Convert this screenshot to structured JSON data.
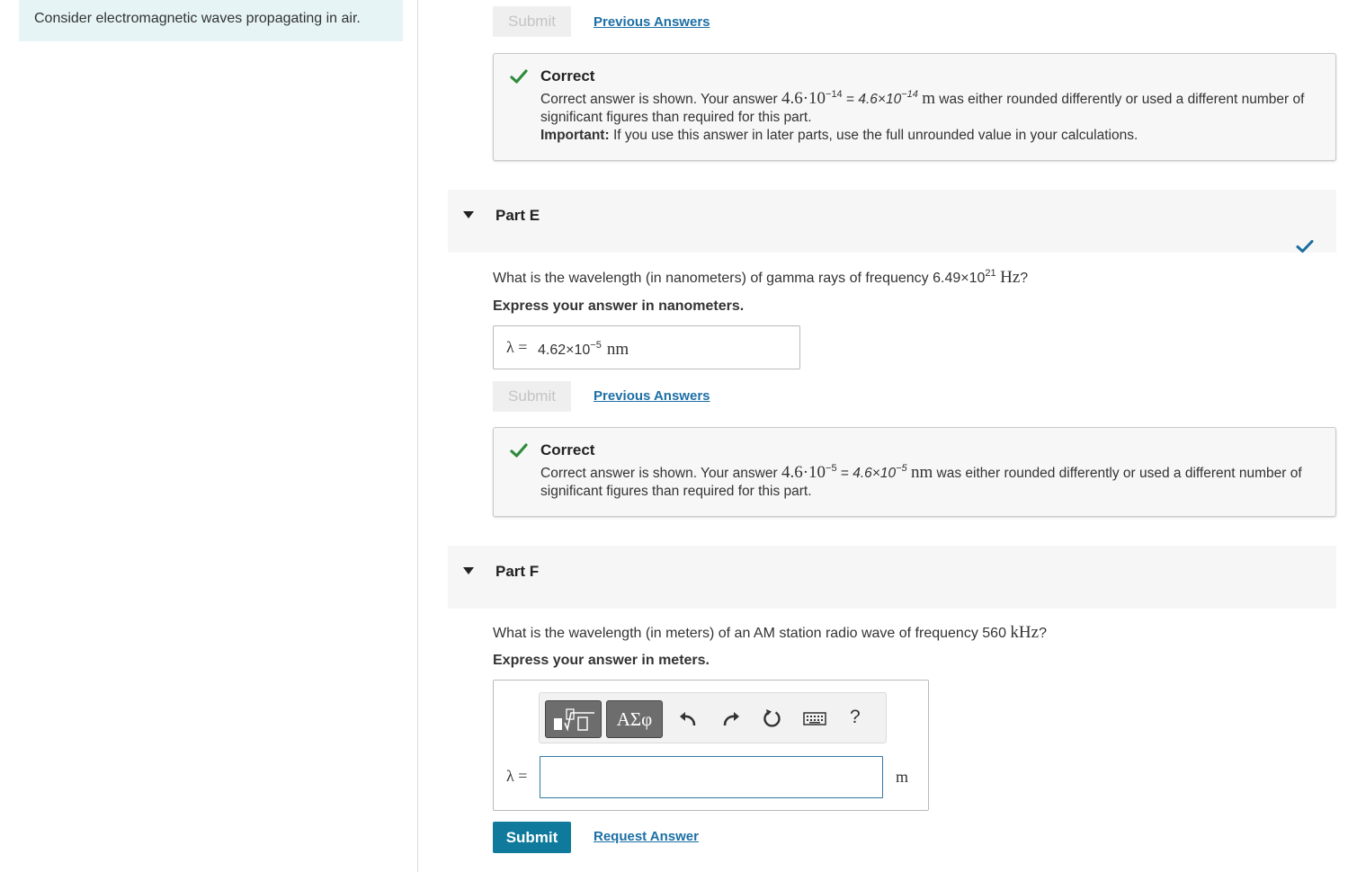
{
  "intro": {
    "text": "Consider electromagnetic waves propagating in air."
  },
  "part_d": {
    "submit_label": "Submit",
    "previous_answers": "Previous Answers",
    "feedback": {
      "title": "Correct",
      "line1_prefix": "Correct answer is shown. Your answer ",
      "answer_mantissa": "4.6·10",
      "answer_exp": "−14",
      "equals": " = ",
      "alt_mantissa": "4.6×10",
      "alt_exp": "−14",
      "unit": "m",
      "line1_suffix": " was either rounded differently or used a different number of significant figures than required for this part.",
      "important_label": "Important:",
      "important_text": " If you use this answer in later parts, use the full unrounded value in your calculations."
    }
  },
  "part_e": {
    "title": "Part E",
    "question_prefix": "What is the wavelength (in nanometers) of gamma rays of frequency 6.49×10",
    "question_exp": "21",
    "question_unit": "Hz",
    "question_suffix": "?",
    "instruction": "Express your answer in nanometers.",
    "answer_symbol": "λ =",
    "answer_mantissa": "4.62×10",
    "answer_exp": "−5",
    "answer_unit": "nm",
    "submit_label": "Submit",
    "previous_answers": "Previous Answers",
    "feedback": {
      "title": "Correct",
      "line1_prefix": "Correct answer is shown. Your answer ",
      "answer_mantissa": "4.6·10",
      "answer_exp": "−5",
      "equals": " = ",
      "alt_mantissa": "4.6×10",
      "alt_exp": "−5",
      "unit": "nm",
      "line1_suffix": " was either rounded differently or used a different number of significant figures than required for this part."
    }
  },
  "part_f": {
    "title": "Part F",
    "question_prefix": "What is the wavelength (in meters) of an AM station radio wave of frequency 560 ",
    "question_unit": "kHz",
    "question_suffix": "?",
    "instruction": "Express your answer in meters.",
    "toolbar": {
      "greek_label": "ΑΣφ",
      "help_label": "?"
    },
    "answer_symbol": "λ =",
    "answer_value": "",
    "answer_unit": "m",
    "submit_label": "Submit",
    "request_answer": "Request Answer"
  },
  "colors": {
    "check_green": "#2e8b3a",
    "link_blue": "#1c6fa6",
    "submit_teal": "#0f7a9c",
    "part_done_check": "#1a6e9e"
  }
}
